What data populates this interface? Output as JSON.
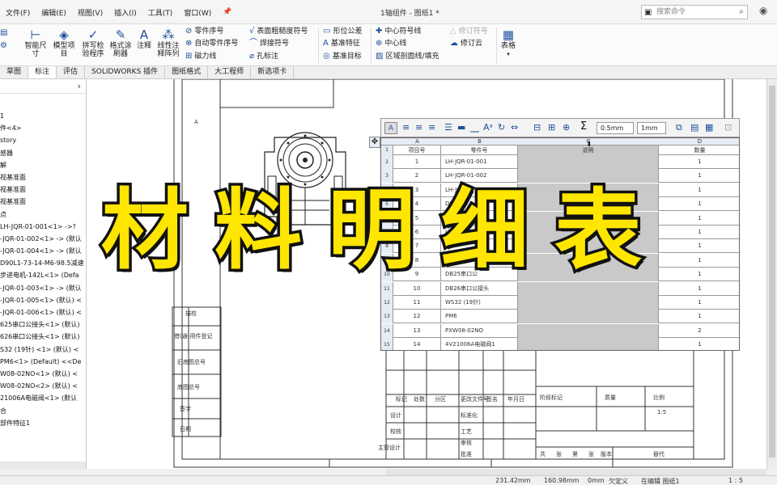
{
  "menu": {
    "items": [
      "文件(F)",
      "编辑(E)",
      "视图(V)",
      "插入(I)",
      "工具(T)",
      "窗口(W)"
    ],
    "doc_title": "1轴组件 - 图纸1 *",
    "search_placeholder": "搜索命令"
  },
  "ribbon": {
    "smart_dim": "智能尺寸",
    "model_items": "模型项目",
    "spell_check": "拼写检验程序",
    "format_painter": "格式涂刷器",
    "note": "注释",
    "linear_note_pattern": "线性注释阵列",
    "balloon": "零件序号",
    "auto_balloon": "自动零件序号",
    "magnetic_line": "磁力线",
    "surface_finish": "表面粗糙度符号",
    "weld_symbol": "焊接符号",
    "hole_callout": "孔标注",
    "geo_tol": "形位公差",
    "datum_feature": "基准特征",
    "datum_target": "基准目标",
    "center_mark": "中心符号线",
    "centerline": "中心线",
    "hatch_fill": "区域剖面线/填充",
    "revision_symbol": "修订符号",
    "revision_cloud": "修订云",
    "tables": "表格"
  },
  "tabs": [
    "草图",
    "标注",
    "评估",
    "SOLIDWORKS 插件",
    "图纸格式",
    "大工程师",
    "新选项卡"
  ],
  "tree": {
    "items": [
      "1",
      "件<4>",
      "story",
      "感器",
      "解",
      "视基准面",
      "视基准面",
      "视基准面",
      "点",
      "LH-JQR-01-001<1> ->?",
      "-JQR-01-002<1> -> (默认",
      "-JQR-01-004<1> -> (默认",
      "D90L1-73-14-M6-98.5减速",
      "步进电机-142L<1> (Defa",
      "-JQR-01-003<1> -> (默认",
      "-JQR-01-005<1> (默认) <",
      "-JQR-01-006<1> (默认) <",
      "625串口公接头<1> (默认)",
      "626串口公接头<1> (默认)",
      "S32 (19针) <1> (默认) <",
      "PM6<1> (Default) <<De",
      "W08-02NO<1> (默认) <",
      "W08-02NO<2> (默认) <",
      "21006A电磁阀<1> (默认",
      "合",
      "部件特征1"
    ]
  },
  "format_toolbar": {
    "line_weight": "0.5mm",
    "line_spacing": "1mm"
  },
  "bom": {
    "col_letters": [
      "A",
      "B",
      "C",
      "D"
    ],
    "header": {
      "item_no": "项目号",
      "part_no": "零件号",
      "desc": "说明",
      "qty": "数量"
    },
    "rows": [
      {
        "rn": "2",
        "item": "1",
        "part": "LH-JQR-01-001",
        "qty": "1"
      },
      {
        "rn": "3",
        "item": "2",
        "part": "LH-JQR-01-002",
        "qty": "1"
      },
      {
        "rn": "4",
        "item": "3",
        "part": "LH-JQR-01-004",
        "qty": "1"
      },
      {
        "rn": "5",
        "item": "4",
        "part": "D90L1-73-14-",
        "qty": "1"
      },
      {
        "rn": "6",
        "item": "5",
        "part": "步进电机",
        "qty": "1"
      },
      {
        "rn": "7",
        "item": "6",
        "part": "LH-",
        "qty": "1"
      },
      {
        "rn": "8",
        "item": "7",
        "part": "LH-",
        "qty": "1"
      },
      {
        "rn": "9",
        "item": "8",
        "part": "LH-",
        "qty": "1"
      },
      {
        "rn": "10",
        "item": "9",
        "part": "DB25串口公",
        "qty": "1"
      },
      {
        "rn": "11",
        "item": "10",
        "part": "DB26串口公接头",
        "qty": "1"
      },
      {
        "rn": "12",
        "item": "11",
        "part": "WS32 (19针)",
        "qty": "1"
      },
      {
        "rn": "13",
        "item": "12",
        "part": "PM6",
        "qty": "1"
      },
      {
        "rn": "14",
        "item": "13",
        "part": "PXW08-02NO",
        "qty": "2"
      },
      {
        "rn": "15",
        "item": "14",
        "part": "4V21006A电磁阀1",
        "qty": "1"
      }
    ]
  },
  "overlay": {
    "title": "材料明细表"
  },
  "title_block": {
    "left_labels": [
      "借(通)用件登记",
      "旧底图总号",
      "底图总号",
      "签字",
      "日期"
    ],
    "left_top": "描校",
    "row_labels": [
      "标记",
      "处数",
      "分区",
      "更改文件号",
      "签名",
      "年月日"
    ],
    "roles": [
      "设计",
      "校核",
      "主管设计"
    ],
    "roles2": [
      "标准化",
      "工艺",
      "审核",
      "批准"
    ],
    "stage": [
      "阶段标记",
      "质量",
      "比例"
    ],
    "scale": "1:5",
    "sheet": [
      "共",
      "张",
      "第",
      "张",
      "版本",
      "替代"
    ]
  },
  "status": {
    "coord_x": "231.42mm",
    "coord_y": "160.98mm",
    "z": "0mm",
    "custom": "欠定义",
    "editing": "在编辑 图纸1",
    "scale": "1 : 5"
  }
}
